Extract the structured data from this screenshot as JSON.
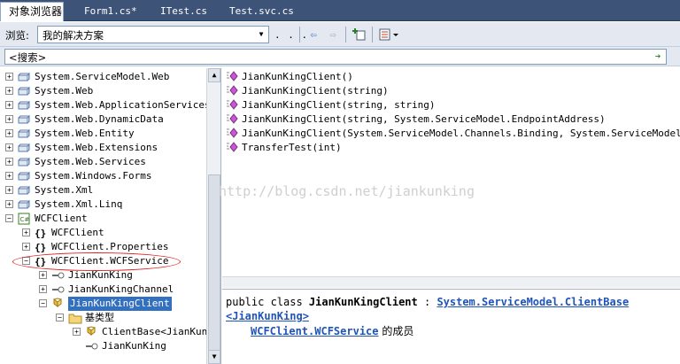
{
  "tabs": [
    {
      "label": "对象浏览器",
      "active": true
    },
    {
      "label": "Form1.cs*",
      "active": false
    },
    {
      "label": "ITest.cs",
      "active": false
    },
    {
      "label": "Test.svc.cs",
      "active": false
    }
  ],
  "toolbar": {
    "browse_label": "浏览:",
    "browse_value": "我的解决方案",
    "ellipsis": ". . ."
  },
  "search": {
    "value": "<搜索>"
  },
  "tree": [
    {
      "expander": "+",
      "icon": "assembly-icon",
      "label": "System.ServiceModel.Web",
      "selected": false
    },
    {
      "expander": "+",
      "icon": "assembly-icon",
      "label": "System.Web",
      "selected": false
    },
    {
      "expander": "+",
      "icon": "assembly-icon",
      "label": "System.Web.ApplicationServices",
      "selected": false
    },
    {
      "expander": "+",
      "icon": "assembly-icon",
      "label": "System.Web.DynamicData",
      "selected": false
    },
    {
      "expander": "+",
      "icon": "assembly-icon",
      "label": "System.Web.Entity",
      "selected": false
    },
    {
      "expander": "+",
      "icon": "assembly-icon",
      "label": "System.Web.Extensions",
      "selected": false
    },
    {
      "expander": "+",
      "icon": "assembly-icon",
      "label": "System.Web.Services",
      "selected": false
    },
    {
      "expander": "+",
      "icon": "assembly-icon",
      "label": "System.Windows.Forms",
      "selected": false
    },
    {
      "expander": "+",
      "icon": "assembly-icon",
      "label": "System.Xml",
      "selected": false
    },
    {
      "expander": "+",
      "icon": "assembly-icon",
      "label": "System.Xml.Linq",
      "selected": false
    },
    {
      "expander": "-",
      "icon": "project-icon",
      "label": "WCFClient",
      "selected": false
    },
    {
      "expander": "+",
      "icon": "namespace-icon",
      "label": "WCFClient",
      "selected": false
    },
    {
      "expander": "+",
      "icon": "namespace-icon",
      "label": "WCFClient.Properties",
      "selected": false
    },
    {
      "expander": "-",
      "icon": "namespace-icon",
      "label": "WCFClient.WCFService",
      "selected": false
    },
    {
      "expander": "+",
      "icon": "interface-icon",
      "label": "JianKunKing",
      "selected": false
    },
    {
      "expander": "+",
      "icon": "interface-icon",
      "label": "JianKunKingChannel",
      "selected": false
    },
    {
      "expander": "-",
      "icon": "class-icon",
      "label": "JianKunKingClient",
      "selected": true
    },
    {
      "expander": "-",
      "icon": "folder-icon",
      "label": "基类型",
      "selected": false
    },
    {
      "expander": "+",
      "icon": "class-icon",
      "label": "ClientBase<JianKunK",
      "selected": false
    },
    {
      "expander": "",
      "icon": "interface-icon",
      "label": "JianKunKing",
      "selected": false
    }
  ],
  "members": [
    "JianKunKingClient()",
    "JianKunKingClient(string)",
    "JianKunKingClient(string, string)",
    "JianKunKingClient(string, System.ServiceModel.EndpointAddress)",
    "JianKunKingClient(System.ServiceModel.Channels.Binding, System.ServiceModel.Endp",
    "TransferTest(int)"
  ],
  "watermark": "http://blog.csdn.net/jiankunking",
  "details": {
    "prefix": "public class ",
    "class_name": "JianKunKingClient",
    "separator": " : ",
    "base_link": "System.ServiceModel.ClientBase",
    "generic_link": "<JianKunKing>",
    "namespace_link": "WCFClient.WCFService",
    "suffix": " 的成员"
  },
  "colors": {
    "selection": "#3370c0",
    "link": "#1f54b8",
    "highlight_circle": "#e02020",
    "tabbar": "#3d5377"
  }
}
